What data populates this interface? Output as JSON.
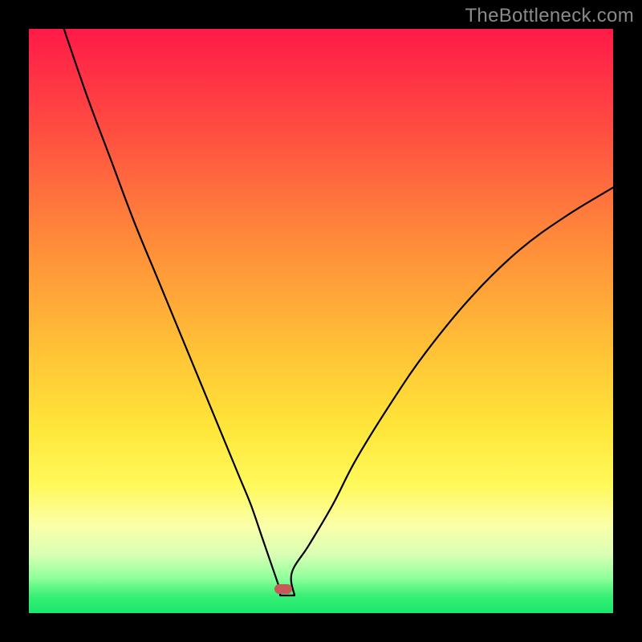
{
  "watermark": "TheBottleneck.com",
  "colors": {
    "frame": "#000000",
    "curve": "#000000",
    "marker": "#c55a58",
    "gradient_top": "#ff1a48",
    "gradient_bottom": "#17e86b"
  },
  "chart_data": {
    "type": "line",
    "title": "",
    "xlabel": "",
    "ylabel": "",
    "xlim": [
      0,
      100
    ],
    "ylim": [
      0,
      100
    ],
    "notch": {
      "x": 43,
      "y": 0
    },
    "marker": {
      "x": 43.5,
      "y": 2,
      "w": 3.0,
      "h": 1.6
    },
    "series": [
      {
        "name": "left-branch",
        "x": [
          6,
          10,
          14,
          18,
          22,
          26,
          30,
          34,
          36,
          38,
          40,
          41,
          42,
          43
        ],
        "y": [
          100,
          88,
          77,
          66,
          56,
          46,
          36,
          26,
          21,
          16,
          10,
          7,
          4,
          1
        ]
      },
      {
        "name": "right-branch",
        "x": [
          43,
          45,
          48,
          52,
          56,
          62,
          68,
          76,
          84,
          92,
          100
        ],
        "y": [
          1,
          4,
          9,
          16,
          24,
          34,
          43,
          53,
          61,
          67,
          72
        ]
      }
    ]
  }
}
